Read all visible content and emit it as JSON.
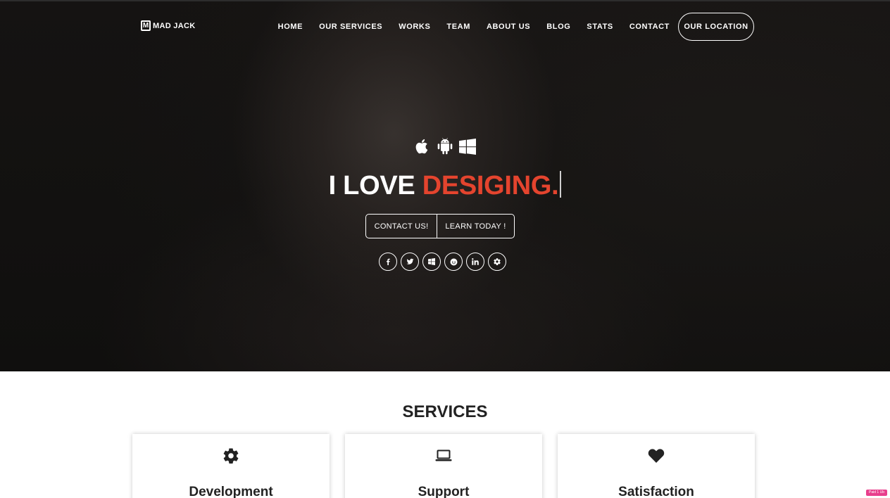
{
  "brand": {
    "logo_mark": "M",
    "name": "MAD JACK"
  },
  "nav": {
    "items": [
      "HOME",
      "OUR SERVICES",
      "WORKS",
      "TEAM",
      "ABOUT US",
      "BLOG",
      "STATS",
      "CONTACT"
    ],
    "cta": "OUR LOCATION"
  },
  "hero": {
    "platform_icons": [
      "apple-icon",
      "android-icon",
      "windows-icon"
    ],
    "headline_prefix": "I LOVE",
    "headline_accent": "DESIGING.",
    "accent_color": "#e4442e",
    "buttons": {
      "contact": "CONTACT US!",
      "learn": "LEARN TODAY !"
    },
    "social_icons": [
      "facebook-icon",
      "twitter-icon",
      "windows-icon",
      "reddit-icon",
      "linkedin-icon",
      "gear-icon"
    ]
  },
  "services": {
    "title": "SERVICES",
    "cards": [
      {
        "icon": "gear-icon",
        "title": "Development"
      },
      {
        "icon": "laptop-icon",
        "title": "Support"
      },
      {
        "icon": "heart-icon",
        "title": "Satisfaction"
      }
    ]
  },
  "badge": "Paid 1 Ub"
}
